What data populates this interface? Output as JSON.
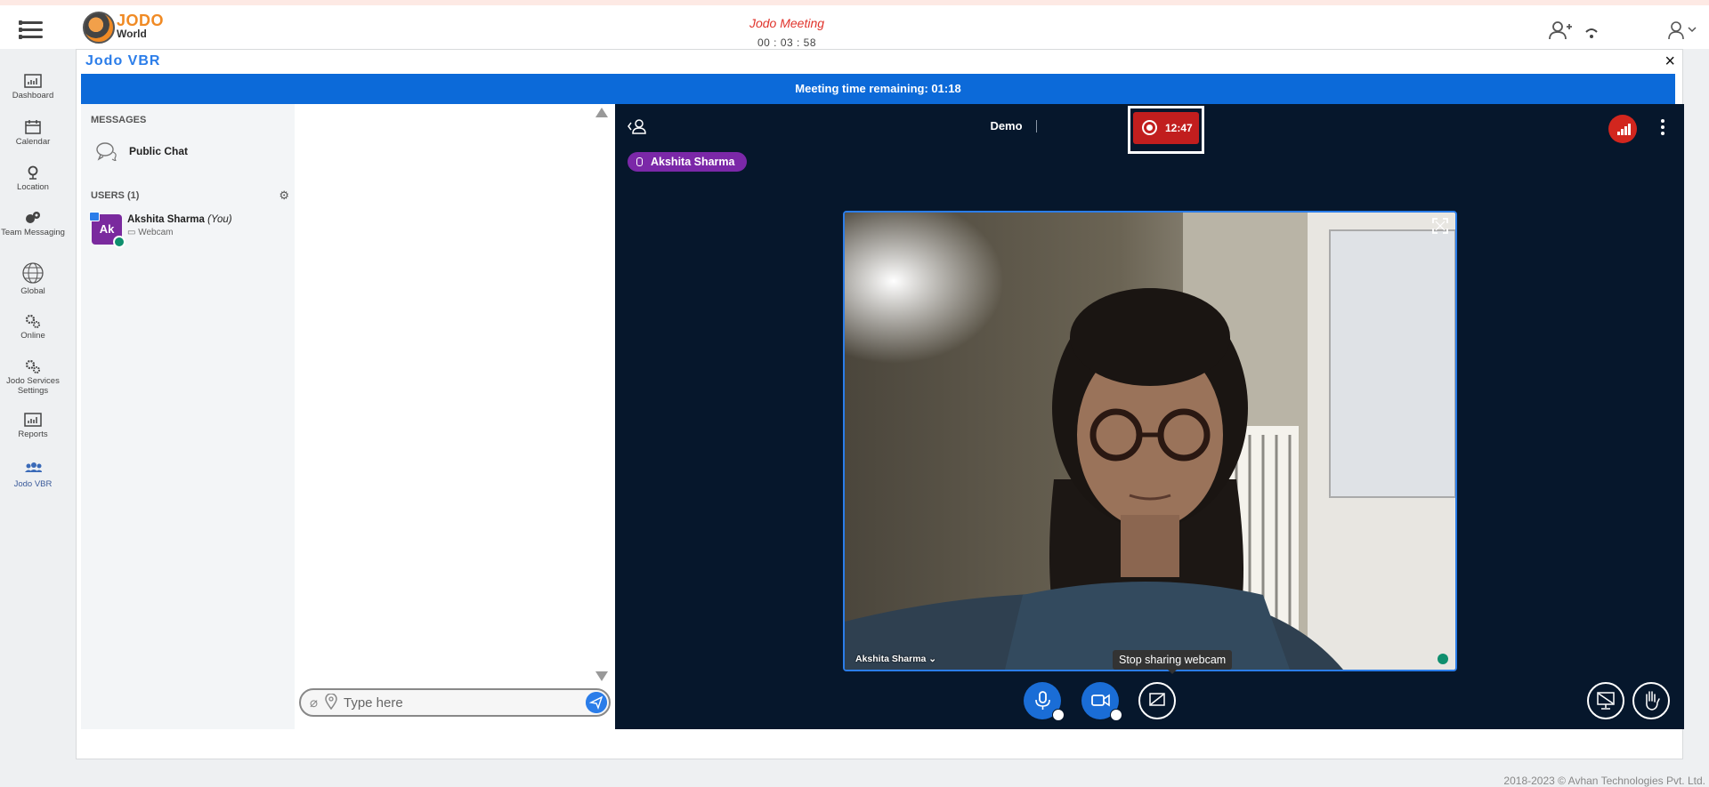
{
  "app": {
    "logo_line1": "JODO",
    "logo_line2": "World",
    "meeting_title": "Jodo Meeting",
    "meeting_clock": "00 : 03 : 58"
  },
  "nav": [
    {
      "label": "Dashboard",
      "icon": "dashboard-icon"
    },
    {
      "label": "Calendar",
      "icon": "calendar-icon"
    },
    {
      "label": "Location",
      "icon": "location-icon"
    },
    {
      "label": "Team Messaging",
      "icon": "team-messaging-icon"
    },
    {
      "label": "Global",
      "icon": "global-icon"
    },
    {
      "label": "Online",
      "icon": "online-icon"
    },
    {
      "label": "Jodo Services Settings",
      "icon": "settings-icon"
    },
    {
      "label": "Reports",
      "icon": "reports-icon"
    },
    {
      "label": "Jodo VBR",
      "icon": "vbr-icon"
    }
  ],
  "panel": {
    "title": "Jodo VBR",
    "close": "×",
    "time_remaining": "Meeting time remaining: 01:18"
  },
  "sidebar": {
    "messages_label": "MESSAGES",
    "public_chat": "Public Chat",
    "users_label": "USERS (1)",
    "user": {
      "initials": "Ak",
      "name": "Akshita Sharma",
      "you": "(You)",
      "status": "Webcam"
    }
  },
  "chat": {
    "placeholder": "Type here"
  },
  "video": {
    "title": "Demo",
    "recording_time": "12:47",
    "talker": "Akshita Sharma",
    "cam_label": "Akshita Sharma ⌄",
    "tooltip": "Stop sharing webcam"
  },
  "footer": "2018-2023 © Avhan Technologies Pvt. Ltd.",
  "colors": {
    "accent": "#0c6ad9",
    "recording": "#c11e1e",
    "video_bg": "#06172c",
    "avatar": "#7a2a9e"
  }
}
